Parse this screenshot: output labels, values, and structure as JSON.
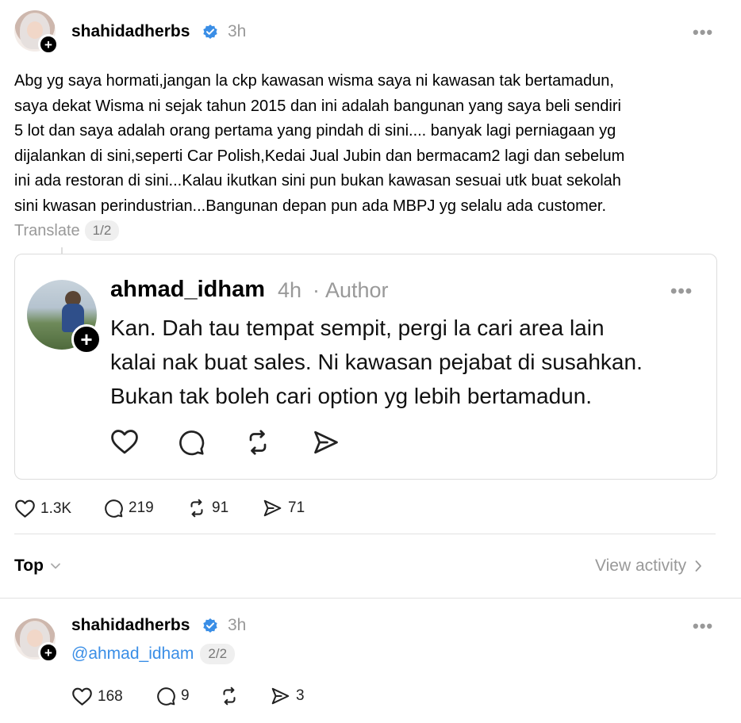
{
  "post": {
    "username": "shahidadherbs",
    "time": "3h",
    "more": "•••",
    "lines": [
      "Abg yg saya hormati,jangan la ckp kawasan wisma saya ni kawasan tak bertamadun,",
      "saya dekat Wisma ni sejak tahun 2015 dan ini adalah bangunan yang saya beli sendiri",
      "5 lot dan saya adalah orang pertama yang pindah di sini.... banyak lagi perniagaan yg",
      "dijalankan di sini,seperti Car Polish,Kedai Jual Jubin dan bermacam2 lagi dan sebelum",
      "ini ada restoran di sini...Kalau ikutkan sini pun bukan kawasan sesuai utk buat sekolah",
      "sini kwasan perindustrian...Bangunan depan pun ada MBPJ yg selalu ada customer."
    ],
    "translate": "Translate",
    "page": "1/2",
    "stats": {
      "likes": "1.3K",
      "replies": "219",
      "reposts": "91",
      "shares": "71"
    }
  },
  "quote": {
    "username": "ahmad_idham",
    "time": "4h",
    "separator": "·",
    "author": "Author",
    "more": "•••",
    "lines": [
      "Kan.  Dah tau tempat sempit, pergi la cari area lain",
      "kalai nak buat sales. Ni kawasan pejabat di susahkan.",
      "Bukan tak boleh cari option yg lebih bertamadun."
    ]
  },
  "sort": {
    "label": "Top",
    "view_activity": "View activity"
  },
  "reply": {
    "username": "shahidadherbs",
    "time": "3h",
    "more": "•••",
    "mention": "@ahmad_idham",
    "page": "2/2",
    "stats": {
      "likes": "168",
      "replies": "9",
      "shares": "3"
    }
  },
  "colors": {
    "verified": "#3a8ee6",
    "muted": "#999999",
    "mention": "#3a8ee6",
    "divider": "#e2e2e2"
  }
}
